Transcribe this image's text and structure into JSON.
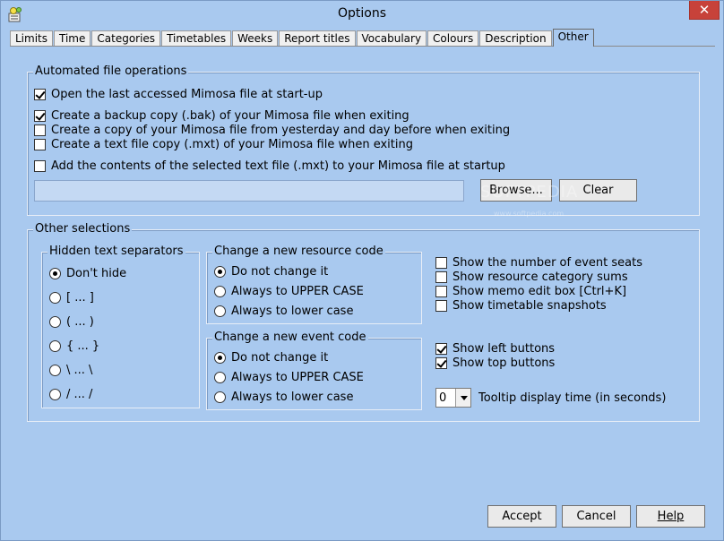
{
  "window": {
    "title": "Options",
    "close_glyph": "✕"
  },
  "tabs": [
    {
      "label": "Limits"
    },
    {
      "label": "Time"
    },
    {
      "label": "Categories"
    },
    {
      "label": "Timetables"
    },
    {
      "label": "Weeks"
    },
    {
      "label": "Report titles"
    },
    {
      "label": "Vocabulary"
    },
    {
      "label": "Colours"
    },
    {
      "label": "Description"
    },
    {
      "label": "Other",
      "active": true
    }
  ],
  "automated": {
    "legend": "Automated file operations",
    "open_last": {
      "label": "Open the last accessed Mimosa file at start-up",
      "checked": true
    },
    "backup_copy": {
      "label": "Create a backup copy (.bak) of your Mimosa file when exiting",
      "checked": true
    },
    "copy_yesterday": {
      "label": "Create a copy of your Mimosa file from yesterday and day before when exiting",
      "checked": false
    },
    "text_copy": {
      "label": "Create a text file copy (.mxt) of your Mimosa file when exiting",
      "checked": false
    },
    "add_contents": {
      "label": "Add the contents of the selected text file (.mxt) to your Mimosa file at startup",
      "checked": false
    },
    "file_path": "",
    "browse_label": "Browse...",
    "clear_label": "Clear"
  },
  "other": {
    "legend": "Other selections",
    "separators": {
      "legend": "Hidden text separators",
      "options": [
        {
          "label": "Don't hide",
          "checked": true
        },
        {
          "label": "[ ... ]",
          "checked": false
        },
        {
          "label": "( ... )",
          "checked": false
        },
        {
          "label": "{ ... }",
          "checked": false
        },
        {
          "label": "\\ ... \\",
          "checked": false
        },
        {
          "label": "/ ... /",
          "checked": false
        }
      ]
    },
    "resource_code": {
      "legend": "Change a new resource code",
      "options": [
        {
          "label": "Do not change it",
          "checked": true
        },
        {
          "label": "Always to UPPER CASE",
          "checked": false
        },
        {
          "label": "Always to lower case",
          "checked": false
        }
      ]
    },
    "event_code": {
      "legend": "Change a new event code",
      "options": [
        {
          "label": "Do not change it",
          "checked": true
        },
        {
          "label": "Always to UPPER CASE",
          "checked": false
        },
        {
          "label": "Always to lower case",
          "checked": false
        }
      ]
    },
    "show": [
      {
        "label": "Show the number of event seats",
        "checked": false
      },
      {
        "label": "Show resource category sums",
        "checked": false
      },
      {
        "label": "Show memo edit box [Ctrl+K]",
        "checked": false
      },
      {
        "label": "Show timetable snapshots",
        "checked": false
      }
    ],
    "buttons_show": [
      {
        "label": "Show left buttons",
        "checked": true
      },
      {
        "label": "Show top buttons",
        "checked": true
      }
    ],
    "tooltip": {
      "value": "0",
      "label": "Tooltip display time (in seconds)"
    }
  },
  "footer": {
    "accept_label": "Accept",
    "cancel_label": "Cancel",
    "help_label": "Help"
  },
  "watermark": {
    "text1": "SOFTPEDIA",
    "text2": "www.softpedia.com"
  }
}
